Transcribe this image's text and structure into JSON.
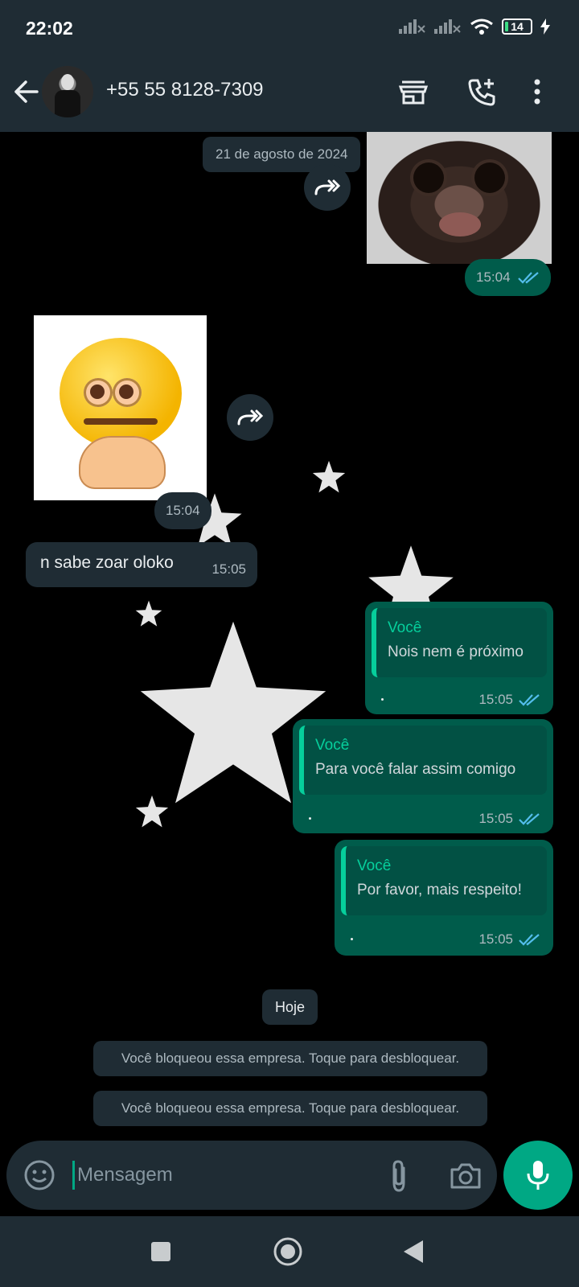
{
  "status_bar": {
    "time": "22:02",
    "battery": "14"
  },
  "header": {
    "contact": "+55 55 8128-7309"
  },
  "chat": {
    "date_chip": "21 de agosto de 2024",
    "messages": [
      {
        "type": "image-out",
        "time": "15:04"
      },
      {
        "type": "sticker-in",
        "time": "15:04"
      },
      {
        "type": "text-in",
        "text": "n sabe zoar oloko",
        "time": "15:05"
      },
      {
        "type": "quote-out",
        "author": "Você",
        "text": "Nois nem é próximo",
        "time": "15:05"
      },
      {
        "type": "quote-out",
        "author": "Você",
        "text": "Para você falar assim comigo",
        "time": "15:05"
      },
      {
        "type": "quote-out",
        "author": "Você",
        "text": "Por favor, mais respeito!",
        "time": "15:05"
      }
    ],
    "today_chip": "Hoje",
    "system_messages": [
      "Você bloqueou essa empresa. Toque para desbloquear.",
      "Você bloqueou essa empresa. Toque para desbloquear."
    ]
  },
  "composer": {
    "placeholder": "Mensagem"
  },
  "colors": {
    "bar": "#1f2c34",
    "outgoing": "#005c4b",
    "accent": "#00a884",
    "tick": "#53bdeb"
  }
}
